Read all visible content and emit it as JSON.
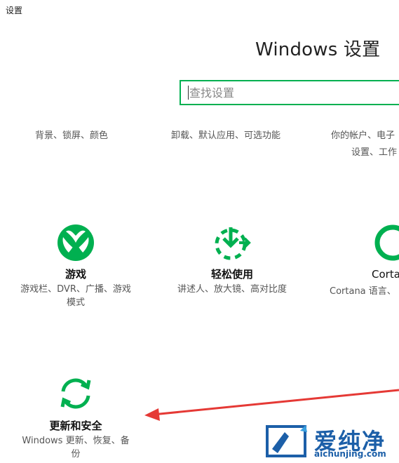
{
  "window": {
    "title": "设置"
  },
  "header": {
    "title": "Windows 设置"
  },
  "search": {
    "placeholder": "查找设置"
  },
  "partial_row": {
    "col1_desc": "背景、锁屏、颜色",
    "col2_desc": "卸载、默认应用、可选功能",
    "col3_desc_line1": "你的帐户、电子",
    "col3_desc_line2": "设置、工作"
  },
  "tiles": [
    {
      "title": "游戏",
      "desc_line1": "游戏栏、DVR、广播、游戏",
      "desc_line2": "模式",
      "icon": "xbox-icon"
    },
    {
      "title": "轻松使用",
      "desc_line1": "讲述人、放大镜、高对比度",
      "icon": "ease-of-access-icon"
    },
    {
      "title": "Corta",
      "desc_line1": "Cortana 语言、",
      "icon": "cortana-icon"
    },
    {
      "title": "更新和安全",
      "desc_line1": "Windows 更新、恢复、备",
      "desc_line2": "份",
      "icon": "update-sync-icon"
    }
  ],
  "watermark": {
    "text": "爱纯净",
    "url": "aichunjing.com"
  },
  "colors": {
    "accent": "#00b050",
    "arrow": "#e53935",
    "watermark": "#1c5fa8"
  }
}
